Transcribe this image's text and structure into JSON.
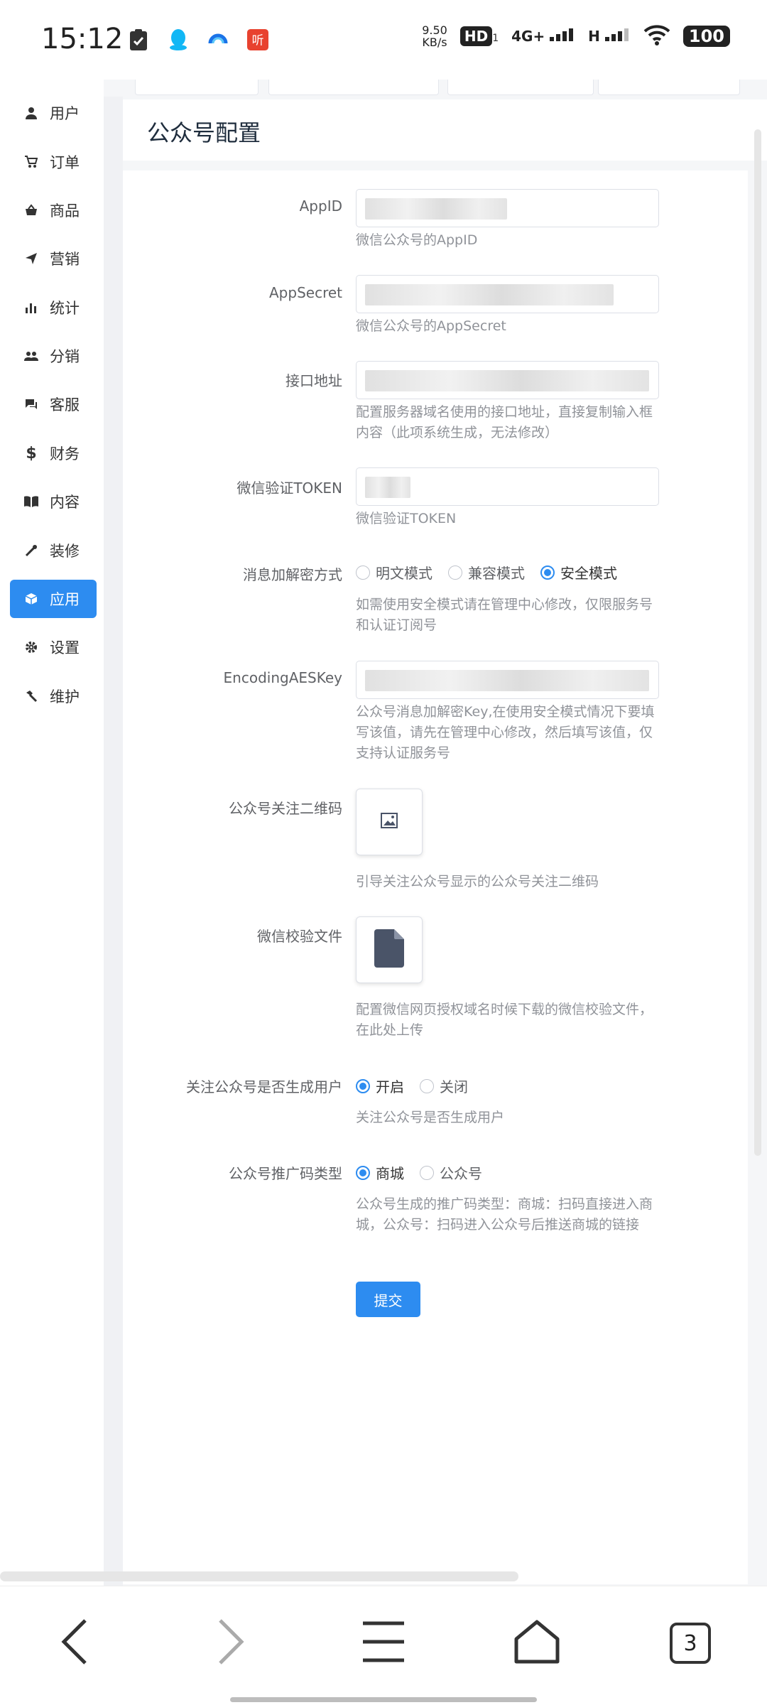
{
  "status_bar": {
    "time": "15:12",
    "speed_value": "9.50",
    "speed_unit": "KB/s",
    "hd_label": "HD",
    "hd_sub": "1",
    "network_4g": "4G+",
    "network_h": "H",
    "battery": "100",
    "icons": [
      "clipboard-check-icon",
      "qq-icon",
      "browser-icon",
      "listen-app-icon",
      "wifi-icon"
    ]
  },
  "sidebar": {
    "items": [
      {
        "label": "用户",
        "icon": "user-icon"
      },
      {
        "label": "订单",
        "icon": "cart-icon"
      },
      {
        "label": "商品",
        "icon": "basket-icon"
      },
      {
        "label": "营销",
        "icon": "send-icon"
      },
      {
        "label": "统计",
        "icon": "bar-chart-icon"
      },
      {
        "label": "分销",
        "icon": "group-icon"
      },
      {
        "label": "客服",
        "icon": "chat-icon"
      },
      {
        "label": "财务",
        "icon": "dollar-icon"
      },
      {
        "label": "内容",
        "icon": "book-icon"
      },
      {
        "label": "装修",
        "icon": "tools-icon"
      },
      {
        "label": "应用",
        "icon": "cube-icon",
        "active": true
      },
      {
        "label": "设置",
        "icon": "gear-icon"
      },
      {
        "label": "维护",
        "icon": "hammer-icon"
      }
    ]
  },
  "page": {
    "title": "公众号配置"
  },
  "form": {
    "appid": {
      "label": "AppID",
      "help": "微信公众号的AppID"
    },
    "appsecret": {
      "label": "AppSecret",
      "help": "微信公众号的AppSecret"
    },
    "api_url": {
      "label": "接口地址",
      "help": "配置服务器域名使用的接口地址，直接复制输入框内容（此项系统生成，无法修改）"
    },
    "token": {
      "label": "微信验证TOKEN",
      "help": "微信验证TOKEN"
    },
    "encrypt_mode": {
      "label": "消息加解密方式",
      "options": [
        "明文模式",
        "兼容模式",
        "安全模式"
      ],
      "selected": "安全模式",
      "help": "如需使用安全模式请在管理中心修改，仅限服务号和认证订阅号"
    },
    "aes_key": {
      "label": "EncodingAESKey",
      "help": "公众号消息加解密Key,在使用安全模式情况下要填写该值，请先在管理中心修改，然后填写该值，仅支持认证服务号"
    },
    "qrcode": {
      "label": "公众号关注二维码",
      "help": "引导关注公众号显示的公众号关注二维码",
      "icon": "image-icon"
    },
    "verify_file": {
      "label": "微信校验文件",
      "help": "配置微信网页授权域名时候下载的微信校验文件，在此处上传",
      "icon": "file-icon"
    },
    "follow_create_user": {
      "label": "关注公众号是否生成用户",
      "options": [
        "开启",
        "关闭"
      ],
      "selected": "开启",
      "help": "关注公众号是否生成用户"
    },
    "promo_code_type": {
      "label": "公众号推广码类型",
      "options": [
        "商城",
        "公众号"
      ],
      "selected": "商城",
      "help": "公众号生成的推广码类型：商城：扫码直接进入商城，公众号：扫码进入公众号后推送商城的链接"
    },
    "submit_label": "提交"
  },
  "bottom_nav": {
    "tab_count": "3",
    "buttons": [
      "back-icon",
      "forward-icon",
      "menu-icon",
      "home-icon",
      "tabs-icon"
    ]
  },
  "colors": {
    "accent": "#2d8cf0",
    "text": "#333333",
    "label": "#606266",
    "help": "#909399",
    "border": "#dcdfe6"
  }
}
